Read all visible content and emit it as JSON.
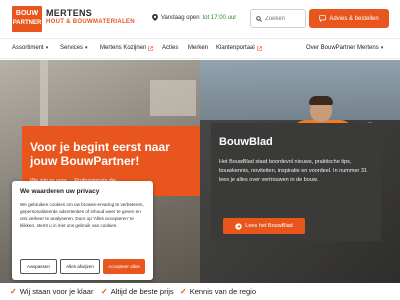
{
  "header": {
    "logo_line1": "BOUW",
    "logo_line2": "PARTNER",
    "brand_name": "MERTENS",
    "brand_sub": "HOUT & BOUWMATERIALEN",
    "open_prefix": "Vandaag open",
    "open_time": "tot 17:00 uur",
    "search_placeholder": "Zoeken",
    "cta_label": "Advies & bestellen"
  },
  "nav": {
    "items": [
      {
        "label": "Assortiment",
        "type": "dropdown"
      },
      {
        "label": "Services",
        "type": "dropdown"
      },
      {
        "label": "Mertens Kozijnen",
        "type": "external"
      },
      {
        "label": "Acties",
        "type": "link"
      },
      {
        "label": "Merken",
        "type": "link"
      },
      {
        "label": "Klantenportaal",
        "type": "external"
      },
      {
        "label": "Over BouwPartner Mertens",
        "type": "dropdown"
      }
    ]
  },
  "hero": {
    "left_title": "Voor je begint eerst naar jouw BouwPartner!",
    "left_sub": "We zijn er voor ... Professionals die",
    "right_title": "BouwBlad",
    "right_text": "Het BouwBlad staat boordevol nieuws, praktische tips, bouwkennis, noviteiten, inspiratie en voordeel. In nummer 31 lees je alles over vertrouwen in de bouw.",
    "right_button": "Lees het BouwBlad"
  },
  "cookie": {
    "title": "We waarderen uw privacy",
    "text": "We gebruiken cookies om uw browse-ervaring te verbeteren, gepersonaliseerde advertenties of inhoud weer te geven en ons verkeer te analyseren. Door op 'Alles accepteren' te klikken, stemt u in met ons gebruik van cookies.",
    "btn_customize": "Aanpassen",
    "btn_reject": "Alles afwijzen",
    "btn_accept": "Accepteer alles"
  },
  "usp": [
    "Wij staan voor je klaar",
    "Altijd de beste prijs",
    "Kennis van de regio"
  ],
  "colors": {
    "brand_orange": "#e8561e",
    "dark_card": "#3a3a39",
    "open_green": "#2a8a2a"
  }
}
